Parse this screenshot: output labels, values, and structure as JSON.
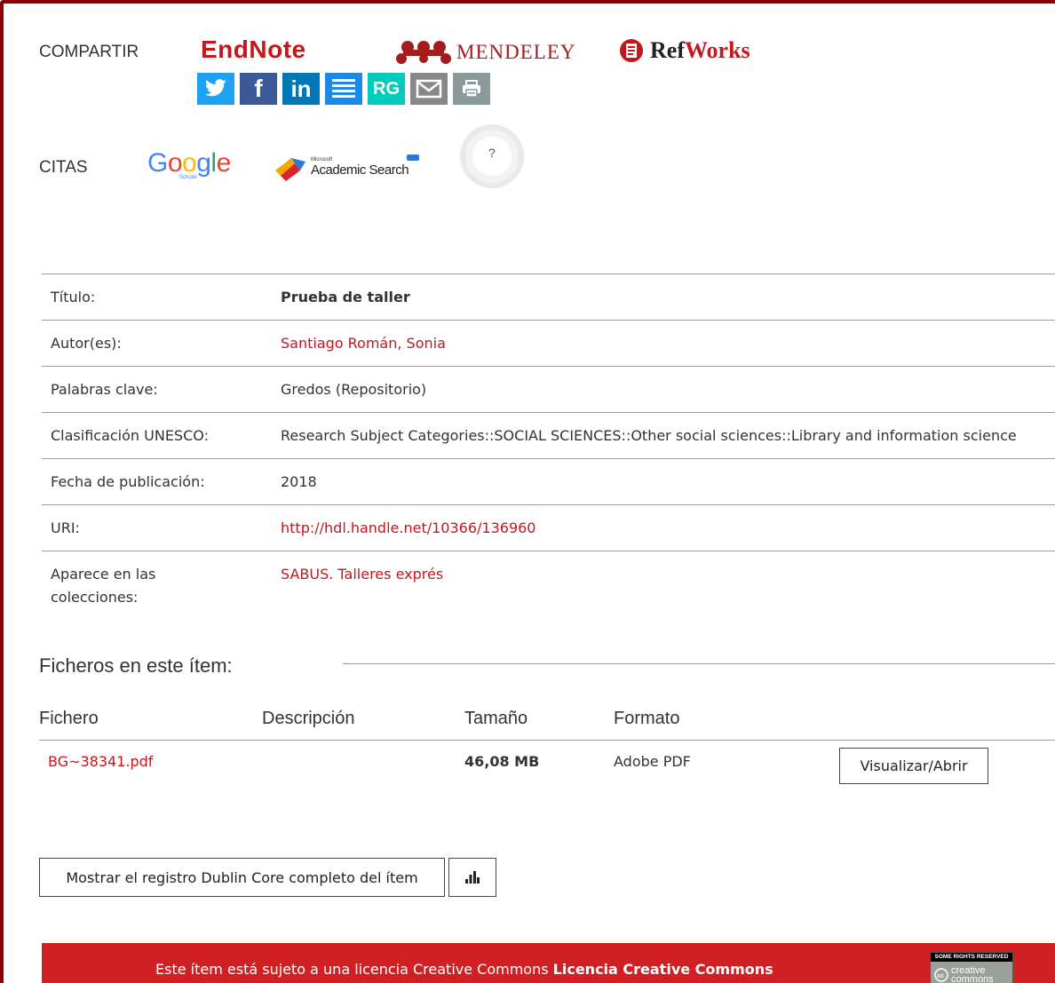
{
  "share": {
    "label": "COMPARTIR",
    "endnote": "EndNote",
    "mendeley": "MENDELEY",
    "refworks_a": "Ref",
    "refworks_b": "Works",
    "buttons": [
      {
        "name": "twitter",
        "text": "",
        "color": "#1da1f2"
      },
      {
        "name": "facebook",
        "text": "f",
        "color": "#3b5998"
      },
      {
        "name": "linkedin",
        "text": "in",
        "color": "#0077b5"
      },
      {
        "name": "list",
        "text": "",
        "color": "#1e88e5"
      },
      {
        "name": "researchgate",
        "text": "RG",
        "color": "#00ccbb"
      },
      {
        "name": "email",
        "text": "",
        "color": "#888888"
      },
      {
        "name": "print",
        "text": "",
        "color": "#8a9a9a"
      }
    ]
  },
  "citations": {
    "label": "CITAS",
    "google": "Google",
    "google_sub": "Scholar",
    "academic_small": "Microsoft",
    "academic": "Academic Search",
    "badge": "?"
  },
  "metadata": [
    {
      "label": "Título:",
      "value": "Prueba de taller",
      "style": "bold"
    },
    {
      "label": "Autor(es):",
      "value": "Santiago Román, Sonia",
      "style": "link"
    },
    {
      "label": "Palabras clave:",
      "value": "Gredos (Repositorio)",
      "style": "plain"
    },
    {
      "label": "Clasificación UNESCO:",
      "value": "Research Subject Categories::SOCIAL SCIENCES::Other social sciences::Library and information science",
      "style": "plain"
    },
    {
      "label": "Fecha de publicación:",
      "value": "2018",
      "style": "plain"
    },
    {
      "label": "URI:",
      "value": "http://hdl.handle.net/10366/136960",
      "style": "link"
    },
    {
      "label": "Aparece en las colecciones:",
      "value": "SABUS. Talleres exprés",
      "style": "link"
    }
  ],
  "files": {
    "title": "Ficheros en este ítem:",
    "headers": [
      "Fichero",
      "Descripción",
      "Tamaño",
      "Formato"
    ],
    "rows": [
      {
        "file": "BG~38341.pdf",
        "description": "",
        "size": "46,08 MB",
        "format": "Adobe PDF",
        "action": "Visualizar/Abrir"
      }
    ]
  },
  "actions": {
    "full_record": "Mostrar el registro Dublin Core completo del ítem"
  },
  "footer": {
    "text": "Este ítem está sujeto a una licencia Creative Commons ",
    "link": "Licencia Creative Commons",
    "cc_top": "SOME RIGHTS RESERVED",
    "cc_main": "creative commons"
  },
  "colors": {
    "accent": "#c4161c",
    "frame": "#8b0000",
    "footer": "#d02024"
  }
}
